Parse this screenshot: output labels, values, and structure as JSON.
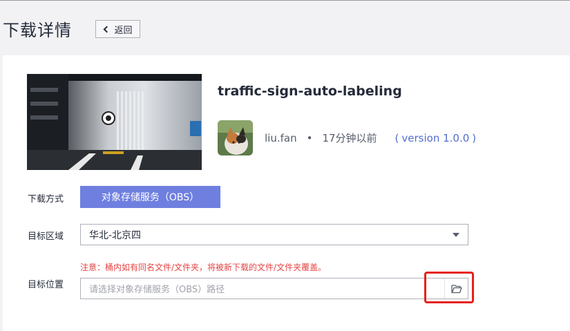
{
  "header": {
    "title": "下载详情",
    "back_label": "返回"
  },
  "dataset": {
    "name": "traffic-sign-auto-labeling",
    "author": "liu.fan",
    "separator": "•",
    "time": "17分钟以前",
    "version": "version 1.0.0",
    "paren_open": "(",
    "paren_close": ")"
  },
  "form": {
    "download_method_label": "下载方式",
    "download_method_value": "对象存储服务（OBS）",
    "target_region_label": "目标区域",
    "target_region_value": "华北-北京四",
    "target_location_label": "目标位置",
    "warning": "注意：桶内如有同名文件/文件夹，将被新下载的文件/文件夹覆盖。",
    "path_placeholder": "请选择对象存储服务（OBS）路径"
  },
  "icons": {
    "back": "chevron-left-icon",
    "dropdown": "caret-down-icon",
    "folder": "folder-open-icon"
  },
  "colors": {
    "primary_button": "#6f7fe0",
    "link": "#526ecc",
    "warning": "#e54545",
    "highlight": "#e6211c"
  }
}
